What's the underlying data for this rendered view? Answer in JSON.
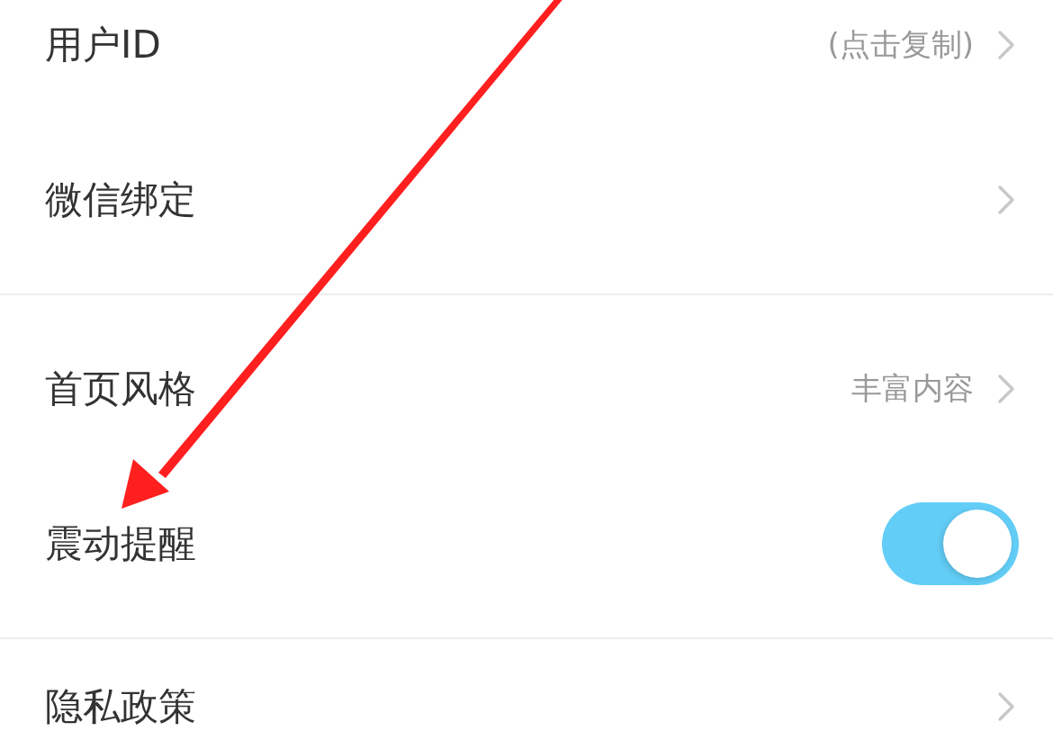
{
  "groups": [
    {
      "rows": [
        {
          "kind": "link",
          "label": "用户ID",
          "value": "(点击复制)"
        },
        {
          "kind": "link",
          "label": "微信绑定"
        }
      ]
    },
    {
      "rows": [
        {
          "kind": "link",
          "label": "首页风格",
          "value": "丰富内容"
        },
        {
          "kind": "toggle",
          "label": "震动提醒",
          "on": true
        }
      ]
    },
    {
      "rows": [
        {
          "kind": "link",
          "label": "隐私政策"
        }
      ]
    }
  ]
}
